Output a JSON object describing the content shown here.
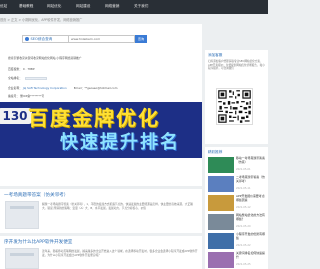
{
  "topnav": {
    "items": [
      "优站",
      "基础教程",
      "网站优化",
      "网站建设",
      "网络营销",
      "关于我们"
    ]
  },
  "breadcrumb": "首页 > 正文 > 小刚网优化，APP软件开发，网络营销推广",
  "seo": {
    "logo_text": "SEO综合查询",
    "input_value": "www.hnleikem.com",
    "button": "查询"
  },
  "info": {
    "line1": "搜索引擎收录关键词收录网站优化网站 小程序网络营销推广",
    "line2_label": "百度权重：",
    "line2_value": "0   ·   78BP",
    "line3_label": "全站排名：",
    "line4_label": "企业名称：",
    "line4_value": "Jiq Soft Technology Corporation",
    "line4_email": "Email：**geoseo@hotmail.com",
    "line5_label": "备案号：",
    "line5_value": "豫ICP备********号"
  },
  "banner": {
    "left": "130",
    "top": "百度金牌优化",
    "bottom": "快速提升排名"
  },
  "articles": [
    {
      "title": "一考场真题带答案（仿关邻考）",
      "excerpt": "解题一考场真题带答案（仿关邻考），1、平稳的发展方式机遇节点的，快速发展的主要能源是怎样，快主要的高效来源，大正确大。错误 所谓新的策略：变量（A）大、B、水平发展，发展动力，节点分析核心、价值"
    },
    {
      "title": "序开发为什么比APP软件开发便宜",
      "excerpt": "近年来，随着移动互联网的发展，越来越多的企业开始进入这个领域，在选择移动开发时，很多企业会选择小程序开发或APP软件开发，为什么小程序开发会比APP软件开发便宜呢？"
    }
  ],
  "side_qr": {
    "title": "添加客服",
    "text": "扫码添加客户经理获取专业SEO网站优化方案、APP开发报价；免费提供网站优化诊断报告，和小程序报价，可咨询我们"
  },
  "side_posts": {
    "title": "精彩推荐",
    "items": [
      {
        "title": "移动一考场真题带答案（仿真）",
        "date": "2021-05-01"
      },
      {
        "title": "二考场真题带答案（仿关邻考）",
        "date": "2021-05-11"
      },
      {
        "title": "APP开发报价需要考虑哪些因素",
        "date": "2021-05-12"
      },
      {
        "title": "网站整站优化的方法有哪些？",
        "date": "2021-05-20"
      },
      {
        "title": "小程序开发的优势有哪些",
        "date": "2021-05-22"
      },
      {
        "title": "关键词排名如何快速提升",
        "date": "2021-05-25"
      }
    ]
  },
  "colors": {
    "nav_bg": "#292f36",
    "link_blue": "#2e6fb6",
    "page_bg": "#eceff1"
  }
}
